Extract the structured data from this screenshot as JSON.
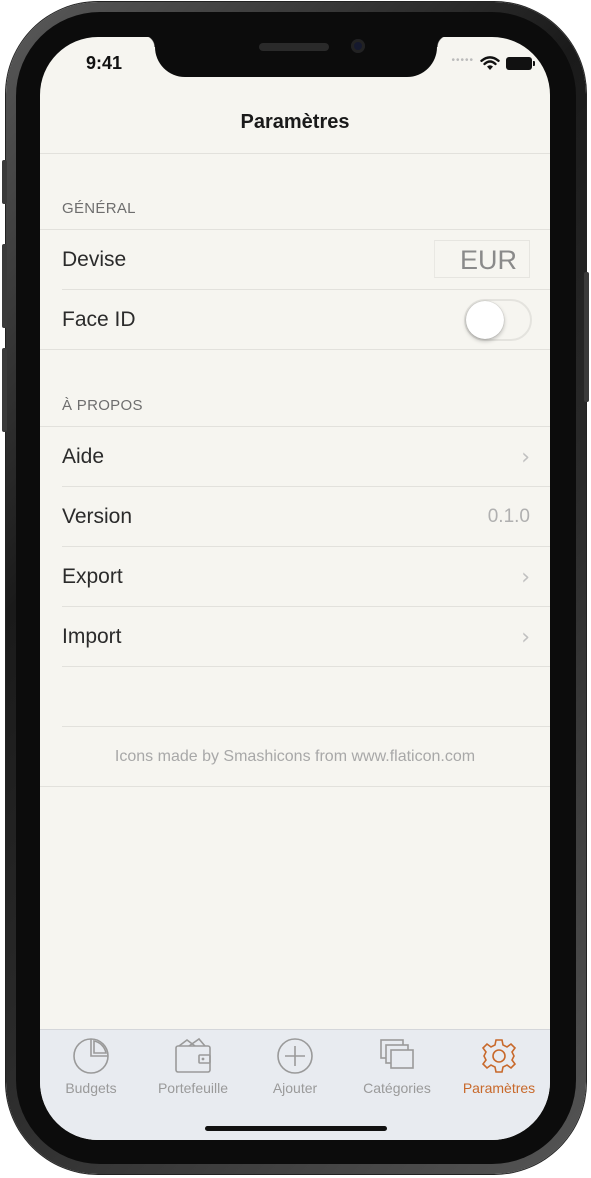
{
  "status": {
    "time": "9:41"
  },
  "nav": {
    "title": "Paramètres"
  },
  "general": {
    "header": "GÉNÉRAL",
    "currency_label": "Devise",
    "currency_value": "EUR",
    "faceid_label": "Face ID",
    "faceid_enabled": false
  },
  "about": {
    "header": "À PROPOS",
    "help_label": "Aide",
    "version_label": "Version",
    "version_value": "0.1.0",
    "export_label": "Export",
    "import_label": "Import"
  },
  "credits": "Icons made by Smashicons from www.flaticon.com",
  "tabs": [
    {
      "label": "Budgets",
      "icon": "pie-chart-icon",
      "active": false
    },
    {
      "label": "Portefeuille",
      "icon": "wallet-icon",
      "active": false
    },
    {
      "label": "Ajouter",
      "icon": "add-circle-icon",
      "active": false
    },
    {
      "label": "Catégories",
      "icon": "stacked-cards-icon",
      "active": false
    },
    {
      "label": "Paramètres",
      "icon": "gear-icon",
      "active": true
    }
  ],
  "colors": {
    "accent": "#c8692b",
    "background": "#f6f5f0",
    "tabbar": "#e8ebf0"
  }
}
